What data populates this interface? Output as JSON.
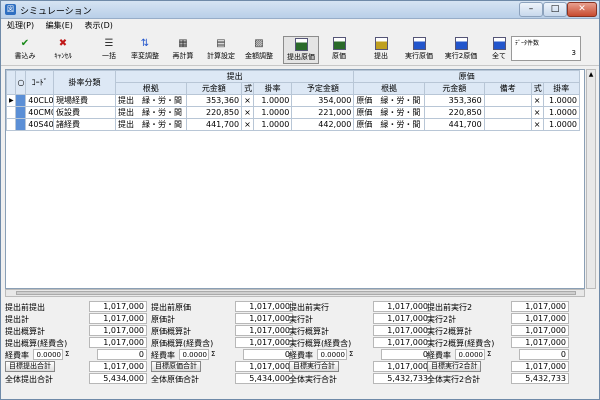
{
  "window": {
    "title": "シミュレーション",
    "app_icon": "app-icon"
  },
  "menu": [
    "処理(P)",
    "編集(E)",
    "表示(D)"
  ],
  "toolbar": [
    {
      "label": "書込み",
      "icon": "check-icon",
      "color": "#1a8a1a"
    },
    {
      "label": "ｷｬﾝｾﾙ",
      "icon": "x-icon",
      "color": "#c01818"
    },
    {
      "label": "一括",
      "icon": "list-icon",
      "color": "#333"
    },
    {
      "label": "率変調整",
      "icon": "arrows-icon",
      "color": "#2255cc"
    },
    {
      "label": "再計算",
      "icon": "calculator-icon",
      "color": "#333"
    },
    {
      "label": "計算設定",
      "icon": "calc-settings-icon",
      "color": "#333"
    },
    {
      "label": "金額調整",
      "icon": "money-adjust-icon",
      "color": "#333"
    },
    {
      "label": "提出原価",
      "icon": "grid-icon",
      "color": "#2a6a2a",
      "pressed": true
    },
    {
      "label": "原価",
      "icon": "grid-icon",
      "color": "#2a6a2a"
    },
    {
      "label": "提出",
      "icon": "grid-icon",
      "color": "#c0a020"
    },
    {
      "label": "実行原価",
      "icon": "grid-icon",
      "color": "#2255cc"
    },
    {
      "label": "実行2原価",
      "icon": "grid-icon",
      "color": "#2255cc"
    },
    {
      "label": "全て",
      "icon": "grid-icon",
      "color": "#2255cc"
    }
  ],
  "data_count": {
    "label": "ﾃﾞｰﾀ件数",
    "value": "3"
  },
  "grid": {
    "header1": {
      "circle": "○",
      "code": "ｺｰﾄﾞ",
      "rate_class": "掛率分類",
      "teishutsu": "提出",
      "genka": "原価"
    },
    "header2": {
      "konkyo": "根拠",
      "motokingaku": "元金額",
      "shiki": "式",
      "kakeritsu": "掛率",
      "yotei": "予定金額",
      "konkyo2": "根拠",
      "motokingaku2": "元金額",
      "biko": "備考",
      "shiki2": "式",
      "kakeritsu2": "掛率"
    },
    "rows": [
      {
        "code": "40CL0",
        "rate_class": "現場経費",
        "konkyo": "提出　緑・労・間",
        "moto": "353,360",
        "shiki": "×",
        "rate": "1.0000",
        "yotei": "354,000",
        "konkyo2": "原価　緑・労・間",
        "moto2": "353,360",
        "biko": "",
        "shiki2": "×",
        "rate2": "1.0000",
        "selected": true
      },
      {
        "code": "40CM0",
        "rate_class": "仮設費",
        "konkyo": "提出　緑・労・間",
        "moto": "220,850",
        "shiki": "×",
        "rate": "1.0000",
        "yotei": "221,000",
        "konkyo2": "原価　緑・労・間",
        "moto2": "220,850",
        "biko": "",
        "shiki2": "×",
        "rate2": "1.0000",
        "selected": false
      },
      {
        "code": "40S40",
        "rate_class": "諸経費",
        "konkyo": "提出　緑・労・間",
        "moto": "441,700",
        "shiki": "×",
        "rate": "1.0000",
        "yotei": "442,000",
        "konkyo2": "原価　緑・労・間",
        "moto2": "441,700",
        "biko": "",
        "shiki2": "×",
        "rate2": "1.0000",
        "selected": false
      }
    ]
  },
  "summary": [
    {
      "rows": [
        {
          "label": "提出前提出",
          "value": "1,017,000"
        },
        {
          "label": "提出計",
          "value": "1,017,000"
        },
        {
          "label": "提出概算計",
          "value": "1,017,000"
        },
        {
          "label": "提出概算(経費含)",
          "value": "1,017,000"
        }
      ],
      "rate_label": "経費率",
      "rate": "0.0000",
      "rate_item": "Σ",
      "rate_value": "0",
      "button": "目標提出合計",
      "button_value": "1,017,000",
      "total_label": "全体提出合計",
      "total_value": "5,434,000"
    },
    {
      "rows": [
        {
          "label": "提出前原価",
          "value": "1,017,000"
        },
        {
          "label": "原価計",
          "value": "1,017,000"
        },
        {
          "label": "原価概算計",
          "value": "1,017,000"
        },
        {
          "label": "原価概算(経費含)",
          "value": "1,017,000"
        }
      ],
      "rate_label": "経費率",
      "rate": "0.0000",
      "rate_item": "Σ",
      "rate_value": "0",
      "button": "目標原価合計",
      "button_value": "1,017,000",
      "total_label": "全体原価合計",
      "total_value": "5,434,000"
    },
    {
      "rows": [
        {
          "label": "提出前実行",
          "value": "1,017,000"
        },
        {
          "label": "実行計",
          "value": "1,017,000"
        },
        {
          "label": "実行概算計",
          "value": "1,017,000"
        },
        {
          "label": "実行概算(経費含)",
          "value": "1,017,000"
        }
      ],
      "rate_label": "経費率",
      "rate": "0.0000",
      "rate_item": "Σ",
      "rate_value": "0",
      "button": "目標実行合計",
      "button_value": "1,017,000",
      "total_label": "全体実行合計",
      "total_value": "5,432,733"
    },
    {
      "rows": [
        {
          "label": "提出前実行2",
          "value": "1,017,000"
        },
        {
          "label": "実行2計",
          "value": "1,017,000"
        },
        {
          "label": "実行2概算計",
          "value": "1,017,000"
        },
        {
          "label": "実行2概算(経費含)",
          "value": "1,017,000"
        }
      ],
      "rate_label": "経費率",
      "rate": "0.0000",
      "rate_item": "Σ",
      "rate_value": "0",
      "button": "目標実行2合計",
      "button_value": "1,017,000",
      "total_label": "全体実行2合計",
      "total_value": "5,432,733"
    }
  ]
}
